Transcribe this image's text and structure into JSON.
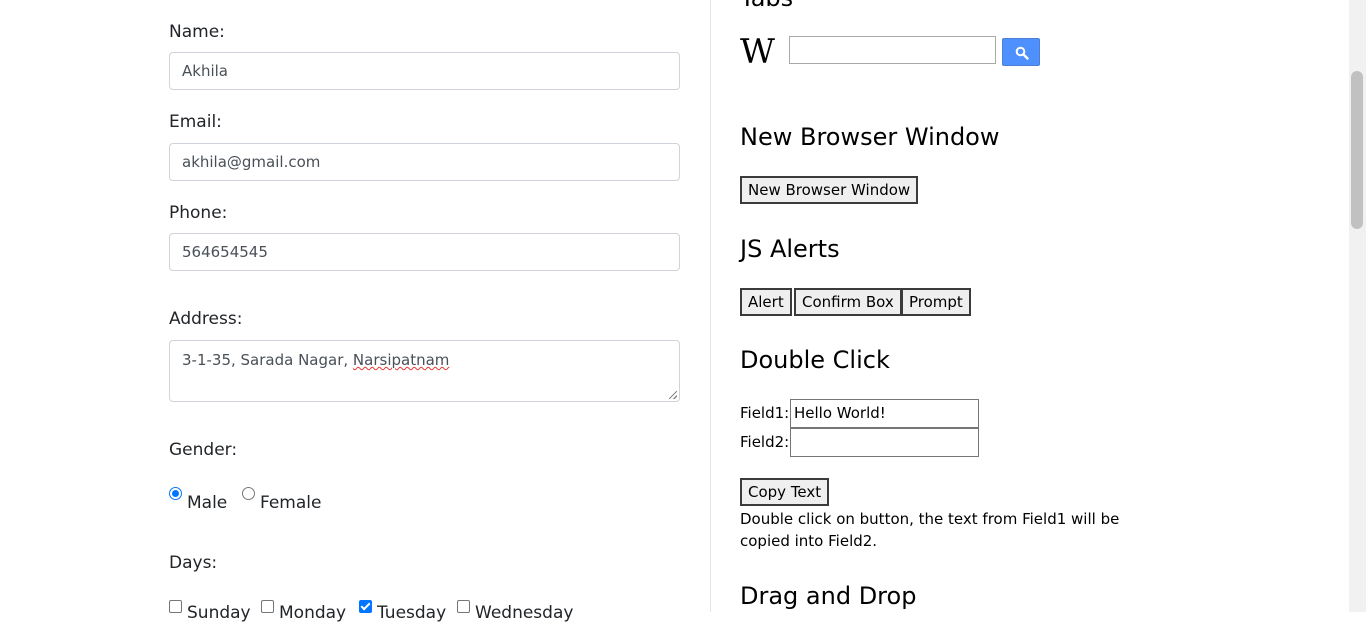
{
  "form": {
    "name_label": "Name:",
    "name_value": "Akhila",
    "email_label": "Email:",
    "email_value": "akhila@gmail.com",
    "phone_label": "Phone:",
    "phone_value": "564654545",
    "address_label": "Address:",
    "address_prefix": "3-1-35, Sarada Nagar, ",
    "address_misspelled": "Narsipatnam",
    "gender_label": "Gender:",
    "gender_options": [
      "Male",
      "Female"
    ],
    "gender_selected": "Male",
    "days_label": "Days:",
    "days": [
      {
        "label": "Sunday",
        "checked": false
      },
      {
        "label": "Monday",
        "checked": false
      },
      {
        "label": "Tuesday",
        "checked": true
      },
      {
        "label": "Wednesday",
        "checked": false
      }
    ]
  },
  "right": {
    "partial_heading": "Tabs",
    "wiki_logo": "W",
    "wiki_search_value": "",
    "new_window_heading": "New Browser Window",
    "new_window_button": "New Browser Window",
    "alerts_heading": "JS Alerts",
    "alert_button": "Alert",
    "confirm_button": "Confirm Box",
    "prompt_button": "Prompt",
    "double_click_heading": "Double Click",
    "field1_label": "Field1:",
    "field1_value": "Hello World!",
    "field2_label": "Field2:",
    "field2_value": "",
    "copy_button": "Copy Text",
    "copy_description": "Double click on button, the text from Field1 will be copied into Field2.",
    "drag_heading": "Drag and Drop"
  },
  "icons": {
    "search": "search-icon"
  },
  "colors": {
    "accent": "#0075ff",
    "search_button": "#4d90fe"
  }
}
